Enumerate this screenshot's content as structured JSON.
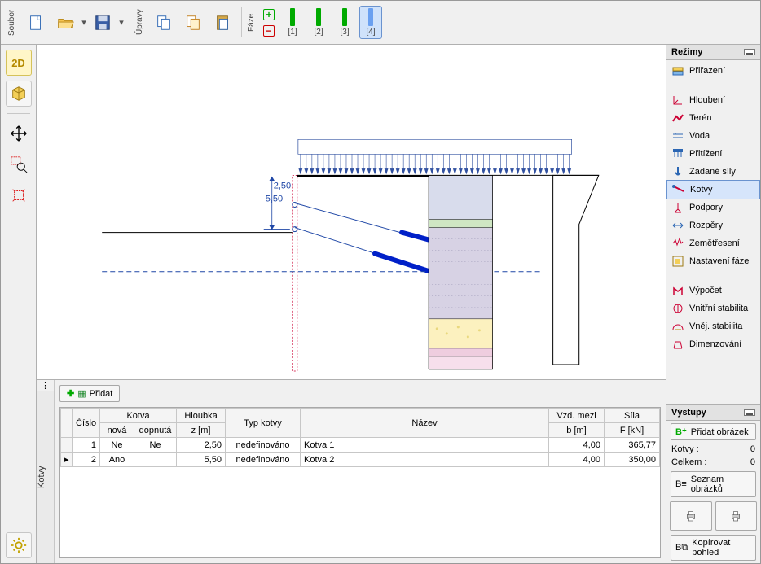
{
  "top": {
    "groups": [
      {
        "label": "Soubor",
        "buttons": [
          "new",
          "open",
          "save"
        ]
      },
      {
        "label": "Úpravy",
        "buttons": [
          "copy",
          "copy-doc",
          "paste"
        ]
      },
      {
        "label": "Fáze",
        "buttons": []
      }
    ],
    "phases": [
      {
        "label": "[1]"
      },
      {
        "label": "[2]"
      },
      {
        "label": "[3]"
      },
      {
        "label": "[4]",
        "active": true
      }
    ]
  },
  "modes": {
    "title": "Režimy",
    "sections": [
      [
        "Přiřazení"
      ],
      [
        "Hloubení",
        "Terén",
        "Voda",
        "Přitížení",
        "Zadané síly",
        "Kotvy",
        "Podpory",
        "Rozpěry",
        "Zemětřesení",
        "Nastavení fáze"
      ],
      [
        "Výpočet",
        "Vnitřní stabilita",
        "Vněj. stabilita",
        "Dimenzování"
      ]
    ],
    "selected": "Kotvy"
  },
  "outputs": {
    "title": "Výstupy",
    "addImage": "Přidat obrázek",
    "counts": [
      {
        "label": "Kotvy :",
        "value": "0"
      },
      {
        "label": "Celkem :",
        "value": "0"
      }
    ],
    "list": "Seznam obrázků",
    "copyView": "Kopírovat pohled"
  },
  "bottom": {
    "tab": "Kotvy",
    "add": "Přidat",
    "columns": {
      "cislo": "Číslo",
      "kotva": "Kotva",
      "nova": "nová",
      "dopnuta": "dopnutá",
      "hloubka": "Hloubka",
      "z": "z [m]",
      "typ": "Typ kotvy",
      "nazev": "Název",
      "vzd": "Vzd. mezi",
      "b": "b [m]",
      "sila": "Síla",
      "f": "F [kN]"
    },
    "rows": [
      {
        "n": "1",
        "nova": "Ne",
        "dop": "Ne",
        "z": "2,50",
        "typ": "nedefinováno",
        "nazev": "Kotva 1",
        "b": "4,00",
        "f": "365,77"
      },
      {
        "n": "2",
        "nova": "Ano",
        "dop": "",
        "z": "5,50",
        "typ": "nedefinováno",
        "nazev": "Kotva 2",
        "b": "4,00",
        "f": "350,00"
      }
    ]
  },
  "drawing": {
    "dim1": "2,50",
    "dim2": "5,50"
  },
  "chart_data": {
    "type": "table",
    "title": "Kotvy",
    "columns": [
      "Číslo",
      "Kotva nová",
      "Kotva dopnutá",
      "Hloubka z [m]",
      "Typ kotvy",
      "Název",
      "Vzd. mezi b [m]",
      "Síla F [kN]"
    ],
    "rows": [
      [
        1,
        "Ne",
        "Ne",
        2.5,
        "nedefinováno",
        "Kotva 1",
        4.0,
        365.77
      ],
      [
        2,
        "Ano",
        "",
        5.5,
        "nedefinováno",
        "Kotva 2",
        4.0,
        350.0
      ]
    ]
  }
}
